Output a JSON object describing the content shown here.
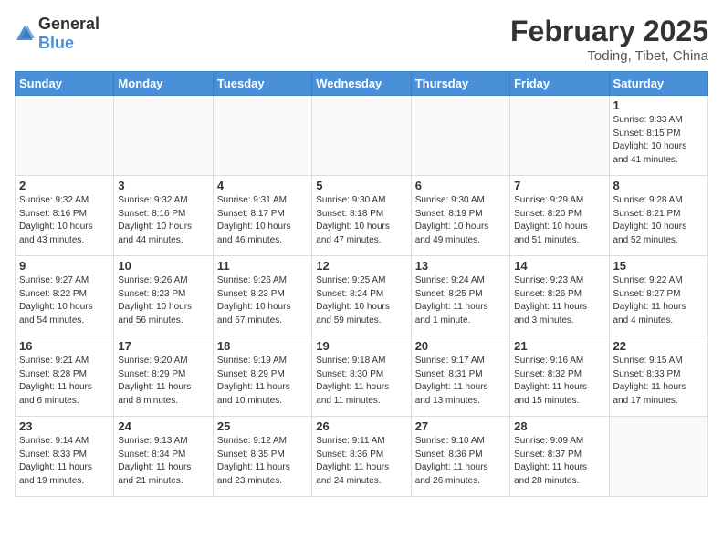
{
  "header": {
    "logo_general": "General",
    "logo_blue": "Blue",
    "month_year": "February 2025",
    "location": "Toding, Tibet, China"
  },
  "days_of_week": [
    "Sunday",
    "Monday",
    "Tuesday",
    "Wednesday",
    "Thursday",
    "Friday",
    "Saturday"
  ],
  "weeks": [
    [
      {
        "num": "",
        "info": ""
      },
      {
        "num": "",
        "info": ""
      },
      {
        "num": "",
        "info": ""
      },
      {
        "num": "",
        "info": ""
      },
      {
        "num": "",
        "info": ""
      },
      {
        "num": "",
        "info": ""
      },
      {
        "num": "1",
        "info": "Sunrise: 9:33 AM\nSunset: 8:15 PM\nDaylight: 10 hours\nand 41 minutes."
      }
    ],
    [
      {
        "num": "2",
        "info": "Sunrise: 9:32 AM\nSunset: 8:16 PM\nDaylight: 10 hours\nand 43 minutes."
      },
      {
        "num": "3",
        "info": "Sunrise: 9:32 AM\nSunset: 8:16 PM\nDaylight: 10 hours\nand 44 minutes."
      },
      {
        "num": "4",
        "info": "Sunrise: 9:31 AM\nSunset: 8:17 PM\nDaylight: 10 hours\nand 46 minutes."
      },
      {
        "num": "5",
        "info": "Sunrise: 9:30 AM\nSunset: 8:18 PM\nDaylight: 10 hours\nand 47 minutes."
      },
      {
        "num": "6",
        "info": "Sunrise: 9:30 AM\nSunset: 8:19 PM\nDaylight: 10 hours\nand 49 minutes."
      },
      {
        "num": "7",
        "info": "Sunrise: 9:29 AM\nSunset: 8:20 PM\nDaylight: 10 hours\nand 51 minutes."
      },
      {
        "num": "8",
        "info": "Sunrise: 9:28 AM\nSunset: 8:21 PM\nDaylight: 10 hours\nand 52 minutes."
      }
    ],
    [
      {
        "num": "9",
        "info": "Sunrise: 9:27 AM\nSunset: 8:22 PM\nDaylight: 10 hours\nand 54 minutes."
      },
      {
        "num": "10",
        "info": "Sunrise: 9:26 AM\nSunset: 8:23 PM\nDaylight: 10 hours\nand 56 minutes."
      },
      {
        "num": "11",
        "info": "Sunrise: 9:26 AM\nSunset: 8:23 PM\nDaylight: 10 hours\nand 57 minutes."
      },
      {
        "num": "12",
        "info": "Sunrise: 9:25 AM\nSunset: 8:24 PM\nDaylight: 10 hours\nand 59 minutes."
      },
      {
        "num": "13",
        "info": "Sunrise: 9:24 AM\nSunset: 8:25 PM\nDaylight: 11 hours\nand 1 minute."
      },
      {
        "num": "14",
        "info": "Sunrise: 9:23 AM\nSunset: 8:26 PM\nDaylight: 11 hours\nand 3 minutes."
      },
      {
        "num": "15",
        "info": "Sunrise: 9:22 AM\nSunset: 8:27 PM\nDaylight: 11 hours\nand 4 minutes."
      }
    ],
    [
      {
        "num": "16",
        "info": "Sunrise: 9:21 AM\nSunset: 8:28 PM\nDaylight: 11 hours\nand 6 minutes."
      },
      {
        "num": "17",
        "info": "Sunrise: 9:20 AM\nSunset: 8:29 PM\nDaylight: 11 hours\nand 8 minutes."
      },
      {
        "num": "18",
        "info": "Sunrise: 9:19 AM\nSunset: 8:29 PM\nDaylight: 11 hours\nand 10 minutes."
      },
      {
        "num": "19",
        "info": "Sunrise: 9:18 AM\nSunset: 8:30 PM\nDaylight: 11 hours\nand 11 minutes."
      },
      {
        "num": "20",
        "info": "Sunrise: 9:17 AM\nSunset: 8:31 PM\nDaylight: 11 hours\nand 13 minutes."
      },
      {
        "num": "21",
        "info": "Sunrise: 9:16 AM\nSunset: 8:32 PM\nDaylight: 11 hours\nand 15 minutes."
      },
      {
        "num": "22",
        "info": "Sunrise: 9:15 AM\nSunset: 8:33 PM\nDaylight: 11 hours\nand 17 minutes."
      }
    ],
    [
      {
        "num": "23",
        "info": "Sunrise: 9:14 AM\nSunset: 8:33 PM\nDaylight: 11 hours\nand 19 minutes."
      },
      {
        "num": "24",
        "info": "Sunrise: 9:13 AM\nSunset: 8:34 PM\nDaylight: 11 hours\nand 21 minutes."
      },
      {
        "num": "25",
        "info": "Sunrise: 9:12 AM\nSunset: 8:35 PM\nDaylight: 11 hours\nand 23 minutes."
      },
      {
        "num": "26",
        "info": "Sunrise: 9:11 AM\nSunset: 8:36 PM\nDaylight: 11 hours\nand 24 minutes."
      },
      {
        "num": "27",
        "info": "Sunrise: 9:10 AM\nSunset: 8:36 PM\nDaylight: 11 hours\nand 26 minutes."
      },
      {
        "num": "28",
        "info": "Sunrise: 9:09 AM\nSunset: 8:37 PM\nDaylight: 11 hours\nand 28 minutes."
      },
      {
        "num": "",
        "info": ""
      }
    ]
  ]
}
